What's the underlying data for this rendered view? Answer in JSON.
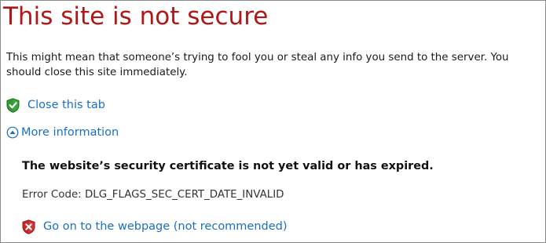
{
  "page": {
    "title": "This site is not secure",
    "description": "This might mean that someone’s trying to fool you or steal any info you send to the server. You should close this site immediately."
  },
  "actions": {
    "close_tab": {
      "label": "Close this tab",
      "icon": "green-shield-check-icon",
      "color": "#1a6fc4"
    },
    "more_information": {
      "label": "More information",
      "icon": "expand-up-arrow-icon",
      "expanded": true
    }
  },
  "details": {
    "heading": "The website’s security certificate is not yet valid or has expired.",
    "error_code": "Error Code: DLG_FLAGS_SEC_CERT_DATE_INVALID",
    "go_on": {
      "label": "Go on to the webpage (not recommended)",
      "icon": "red-shield-x-icon"
    }
  },
  "colors": {
    "title": "#b01717",
    "link": "#1a6fc4",
    "safe_shield": "#2f9a2f",
    "danger_shield": "#c62828"
  }
}
